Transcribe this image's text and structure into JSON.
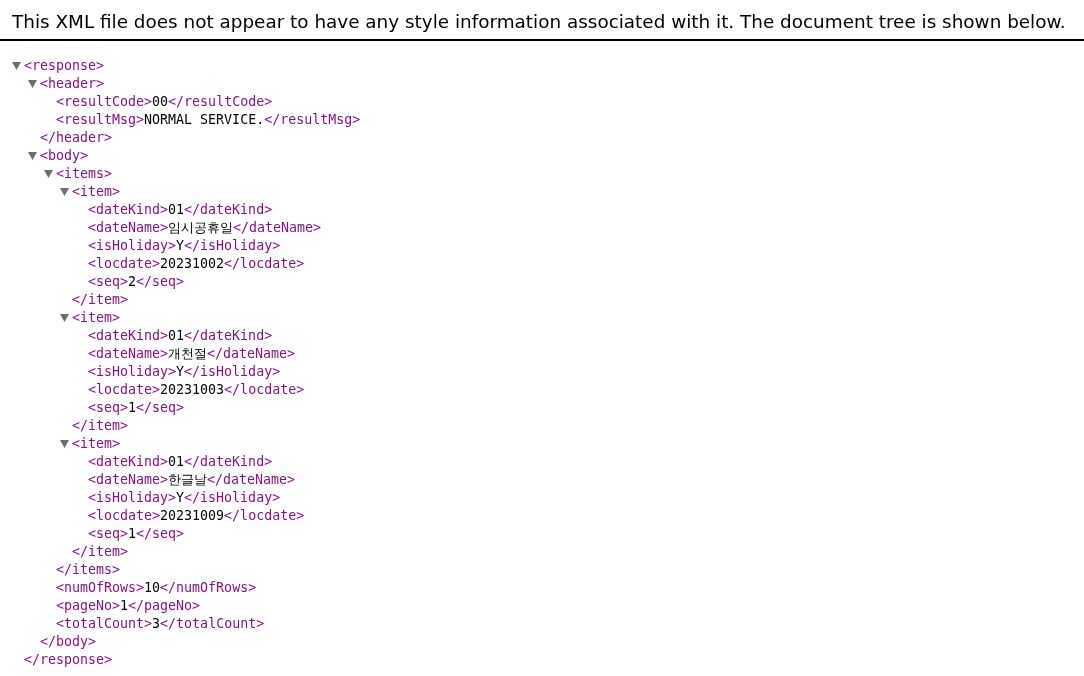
{
  "info": "This XML file does not appear to have any style information associated with it. The document tree is shown below.",
  "tree": {
    "open": "<response>",
    "close": "</response>",
    "expanded": true,
    "children": [
      {
        "open": "<header>",
        "close": "</header>",
        "expanded": true,
        "children": [
          {
            "open": "<resultCode>",
            "text": "00",
            "close": "</resultCode>"
          },
          {
            "open": "<resultMsg>",
            "text": "NORMAL SERVICE.",
            "close": "</resultMsg>"
          }
        ]
      },
      {
        "open": "<body>",
        "close": "</body>",
        "expanded": true,
        "children": [
          {
            "open": "<items>",
            "close": "</items>",
            "expanded": true,
            "children": [
              {
                "open": "<item>",
                "close": "</item>",
                "expanded": true,
                "children": [
                  {
                    "open": "<dateKind>",
                    "text": "01",
                    "close": "</dateKind>"
                  },
                  {
                    "open": "<dateName>",
                    "text": "임시공휴일",
                    "close": "</dateName>"
                  },
                  {
                    "open": "<isHoliday>",
                    "text": "Y",
                    "close": "</isHoliday>"
                  },
                  {
                    "open": "<locdate>",
                    "text": "20231002",
                    "close": "</locdate>"
                  },
                  {
                    "open": "<seq>",
                    "text": "2",
                    "close": "</seq>"
                  }
                ]
              },
              {
                "open": "<item>",
                "close": "</item>",
                "expanded": true,
                "children": [
                  {
                    "open": "<dateKind>",
                    "text": "01",
                    "close": "</dateKind>"
                  },
                  {
                    "open": "<dateName>",
                    "text": "개천절",
                    "close": "</dateName>"
                  },
                  {
                    "open": "<isHoliday>",
                    "text": "Y",
                    "close": "</isHoliday>"
                  },
                  {
                    "open": "<locdate>",
                    "text": "20231003",
                    "close": "</locdate>"
                  },
                  {
                    "open": "<seq>",
                    "text": "1",
                    "close": "</seq>"
                  }
                ]
              },
              {
                "open": "<item>",
                "close": "</item>",
                "expanded": true,
                "children": [
                  {
                    "open": "<dateKind>",
                    "text": "01",
                    "close": "</dateKind>"
                  },
                  {
                    "open": "<dateName>",
                    "text": "한글날",
                    "close": "</dateName>"
                  },
                  {
                    "open": "<isHoliday>",
                    "text": "Y",
                    "close": "</isHoliday>"
                  },
                  {
                    "open": "<locdate>",
                    "text": "20231009",
                    "close": "</locdate>"
                  },
                  {
                    "open": "<seq>",
                    "text": "1",
                    "close": "</seq>"
                  }
                ]
              }
            ]
          },
          {
            "open": "<numOfRows>",
            "text": "10",
            "close": "</numOfRows>"
          },
          {
            "open": "<pageNo>",
            "text": "1",
            "close": "</pageNo>"
          },
          {
            "open": "<totalCount>",
            "text": "3",
            "close": "</totalCount>"
          }
        ]
      }
    ]
  }
}
